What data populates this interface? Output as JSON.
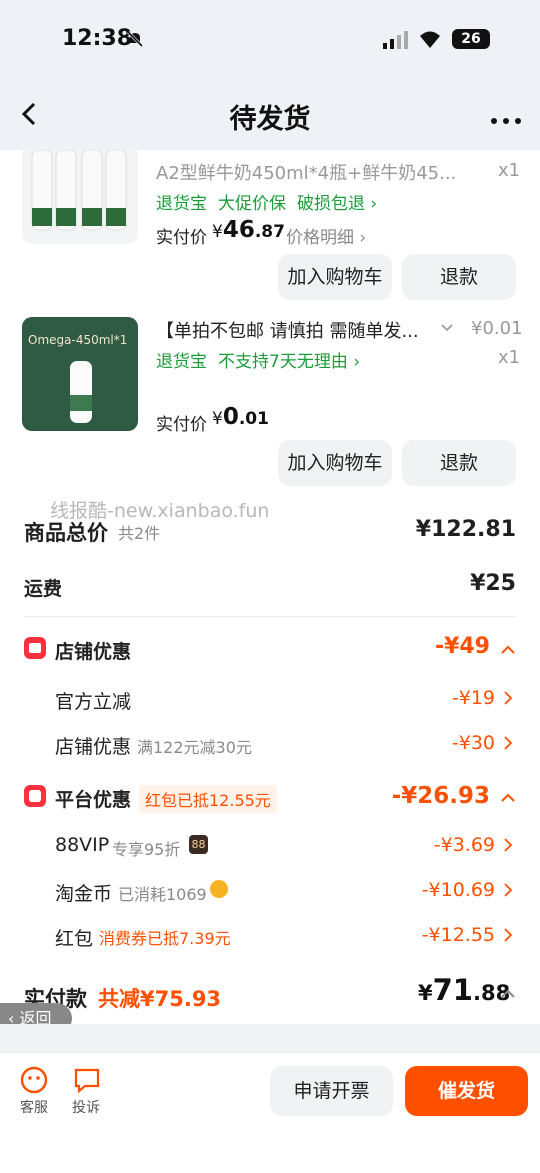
{
  "status": {
    "time": "12:38",
    "battery": "26"
  },
  "header": {
    "title": "待发货"
  },
  "items": [
    {
      "name": "A2型鲜牛奶450ml*4瓶+鲜牛奶45...",
      "qty": "x1",
      "tags": [
        "退货宝",
        "大促价保",
        "破损包退 ›"
      ],
      "paid_label": "实付价",
      "price_symbol": "¥",
      "price_int": "46",
      "price_dec": ".87",
      "detail_link": "价格明细 ›",
      "add_cart": "加入购物车",
      "refund": "退款"
    },
    {
      "name": "【单拍不包邮 请慎拍 需随单发...",
      "unit_price": "¥0.01",
      "qty": "x1",
      "tags": [
        "退货宝",
        "不支持7天无理由 ›"
      ],
      "paid_label": "实付价",
      "price_symbol": "¥",
      "price_int": "0",
      "price_dec": ".01",
      "image_text": "Omega-450ml*1",
      "add_cart": "加入购物车",
      "refund": "退款"
    }
  ],
  "watermark": "线报酷-new.xianbao.fun",
  "summary": {
    "total_label": "商品总价",
    "total_count": "共2件",
    "total_value": "¥122.81",
    "shipping_label": "运费",
    "shipping_value": "¥25",
    "shop_discount_label": "店铺优惠",
    "shop_discount_value": "-¥49",
    "official_label": "官方立减",
    "official_value": "-¥19",
    "shop_coupon_label": "店铺优惠",
    "shop_coupon_sub": "满122元减30元",
    "shop_coupon_value": "-¥30",
    "platform_label": "平台优惠",
    "platform_tag": "红包已抵12.55元",
    "platform_value": "-¥26.93",
    "vip_label": "88VIP",
    "vip_sub": "专享95折",
    "vip_badge": "88",
    "vip_value": "-¥3.69",
    "coin_label": "淘金币",
    "coin_sub": "已消耗1069",
    "coin_value": "-¥10.69",
    "redpack_label": "红包",
    "redpack_sub": "消费券已抵7.39元",
    "redpack_value": "-¥12.55",
    "paid_label": "实付款",
    "saved": "共减¥75.93",
    "paid_symbol": "¥",
    "paid_int": "71",
    "paid_dec": ".88"
  },
  "back_float": "返回",
  "bottom": {
    "service": "客服",
    "complaint": "投诉",
    "invoice": "申请开票",
    "urge": "催发货"
  },
  "colors": {
    "accent": "#ff5000",
    "green": "#1a9d3a"
  }
}
